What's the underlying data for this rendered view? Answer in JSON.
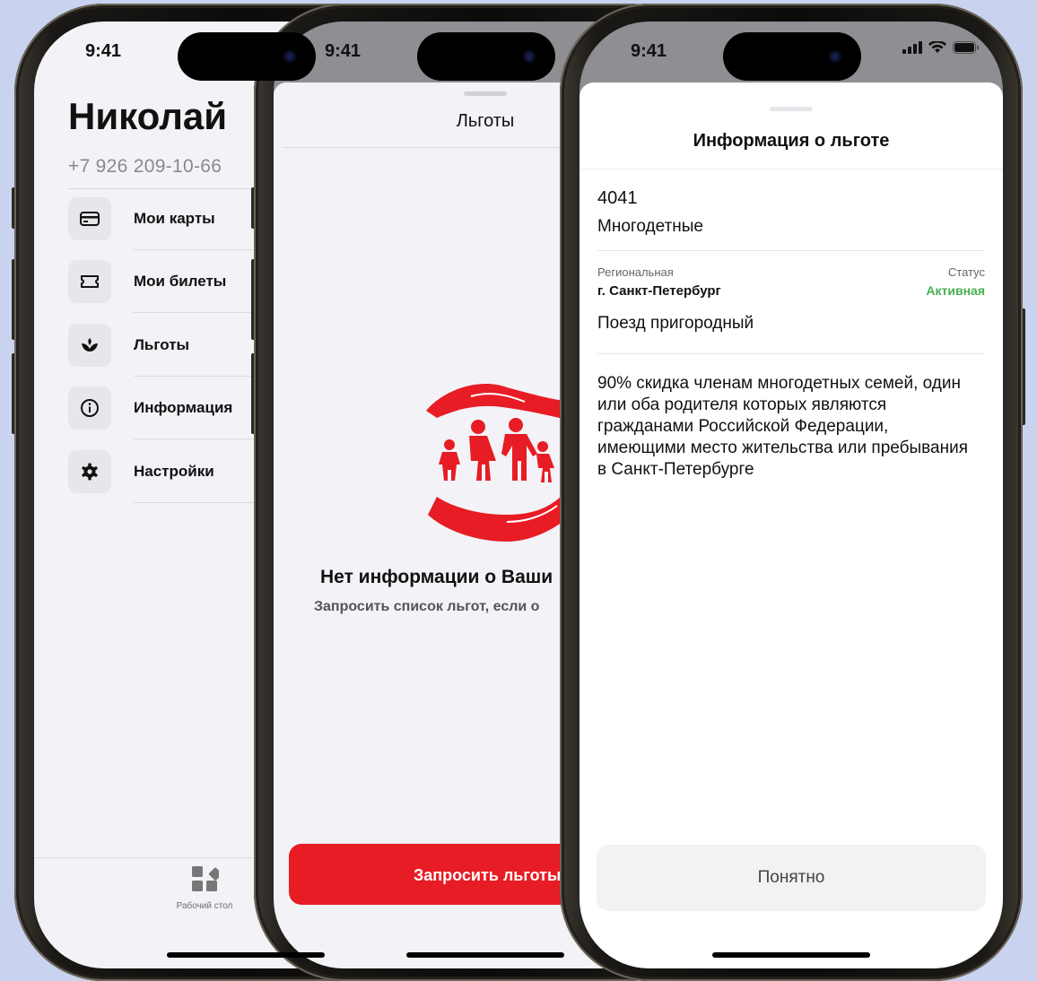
{
  "colors": {
    "background": "#c9d3ef",
    "accent_red": "#e71c24",
    "status_active": "#4caf50"
  },
  "status_bar": {
    "time": "9:41"
  },
  "profile": {
    "name": "Николай",
    "phone": "+7 926 209-10-66",
    "menu": [
      {
        "label": "Мои карты",
        "icon": "card-icon"
      },
      {
        "label": "Мои билеты",
        "icon": "ticket-icon"
      },
      {
        "label": "Льготы",
        "icon": "lotus-icon"
      },
      {
        "label": "Информация",
        "icon": "info-icon"
      },
      {
        "label": "Настройки",
        "icon": "gear-icon"
      }
    ],
    "tabbar": {
      "desktop_label": "Рабочий стол",
      "desktop_icon": "widgets-icon"
    }
  },
  "benefits": {
    "title": "Льготы",
    "illustration": "family-in-hands-illustration",
    "empty_title": "Нет информации о Ваши",
    "empty_subtitle": "Запросить список льгот, если о",
    "request_button": "Запросить льготы"
  },
  "benefit_info": {
    "title": "Информация о льготе",
    "code": "4041",
    "category": "Многодетные",
    "region_type": "Региональная",
    "city": "г. Санкт-Петербург",
    "status_label": "Статус",
    "status_value": "Активная",
    "transport": "Поезд пригородный",
    "description": "90% скидка  членам многодетных семей, один или оба родителя которых являются гражданами Российской Федерации, имеющими место жительства или пребывания в Санкт-Петербурге",
    "ok_button": "Понятно"
  }
}
